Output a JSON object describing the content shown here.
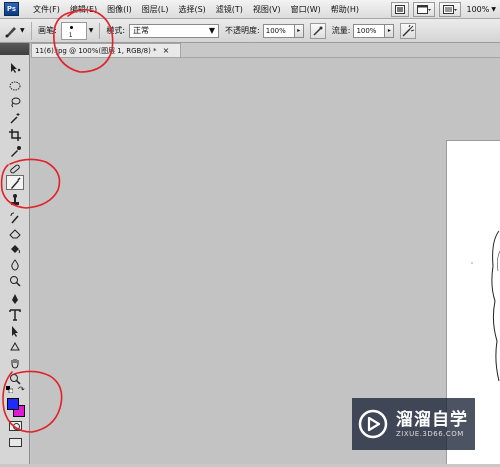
{
  "app": {
    "logo": "Ps"
  },
  "menubar": {
    "items": [
      "文件(F)",
      "编辑(E)",
      "图像(I)",
      "图层(L)",
      "选择(S)",
      "滤镜(T)",
      "视图(V)",
      "窗口(W)",
      "帮助(H)"
    ],
    "zoom": "100%"
  },
  "options": {
    "brush_label": "画笔:",
    "brush_size": "1",
    "mode_label": "模式:",
    "mode_value": "正常",
    "opacity_label": "不透明度:",
    "opacity_value": "100%",
    "flow_label": "流量:",
    "flow_value": "100%"
  },
  "document": {
    "tab_title": "11(6).jpg @ 100%(图层 1, RGB/8) *",
    "close_glyph": "×"
  },
  "colors": {
    "foreground": "#1d2bff",
    "background": "#e01ad6",
    "annotation": "#e0232a"
  },
  "watermark": {
    "title": "溜溜自学",
    "url": "ZIXUE.3D66.COM"
  }
}
